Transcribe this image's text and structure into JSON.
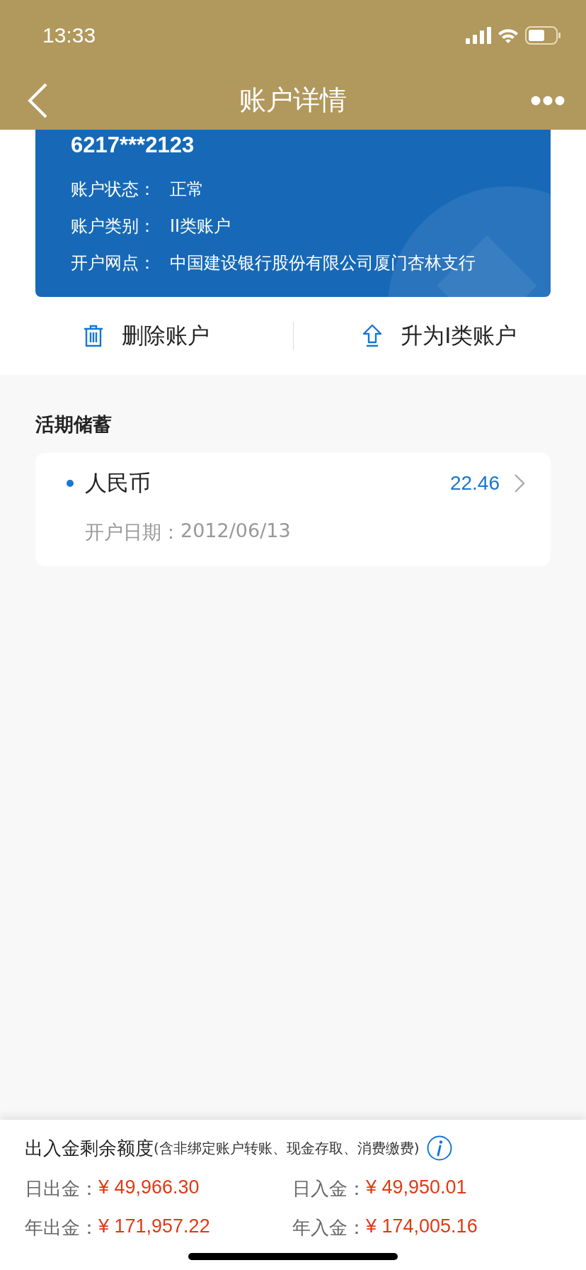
{
  "status_bar": {
    "time": "13:33"
  },
  "nav": {
    "title": "账户详情"
  },
  "account_card": {
    "number": "6217***2123",
    "fields": [
      {
        "label": "账户状态：",
        "value": "正常"
      },
      {
        "label": "账户类别：",
        "value": "II类账户"
      },
      {
        "label": "开户网点：",
        "value": "中国建设银行股份有限公司厦门杏林支行"
      }
    ]
  },
  "actions": [
    {
      "label": "删除账户",
      "kind": "delete"
    },
    {
      "label": "升为I类账户",
      "kind": "upgrade"
    }
  ],
  "section": {
    "title": "活期储蓄",
    "items": [
      {
        "currency": "人民币",
        "balance": "22.46",
        "date_label": "开户日期：",
        "date": "2012/06/13"
      }
    ]
  },
  "limits": {
    "title": "出入金剩余额度",
    "note": "(含非绑定账户转账、现金存取、消费缴费)",
    "items": [
      {
        "label": "日出金：",
        "amount": "¥ 49,966.30"
      },
      {
        "label": "日入金：",
        "amount": "¥ 49,950.01"
      },
      {
        "label": "年出金：",
        "amount": "¥ 171,957.22"
      },
      {
        "label": "年入金：",
        "amount": "¥ 174,005.16"
      }
    ]
  }
}
